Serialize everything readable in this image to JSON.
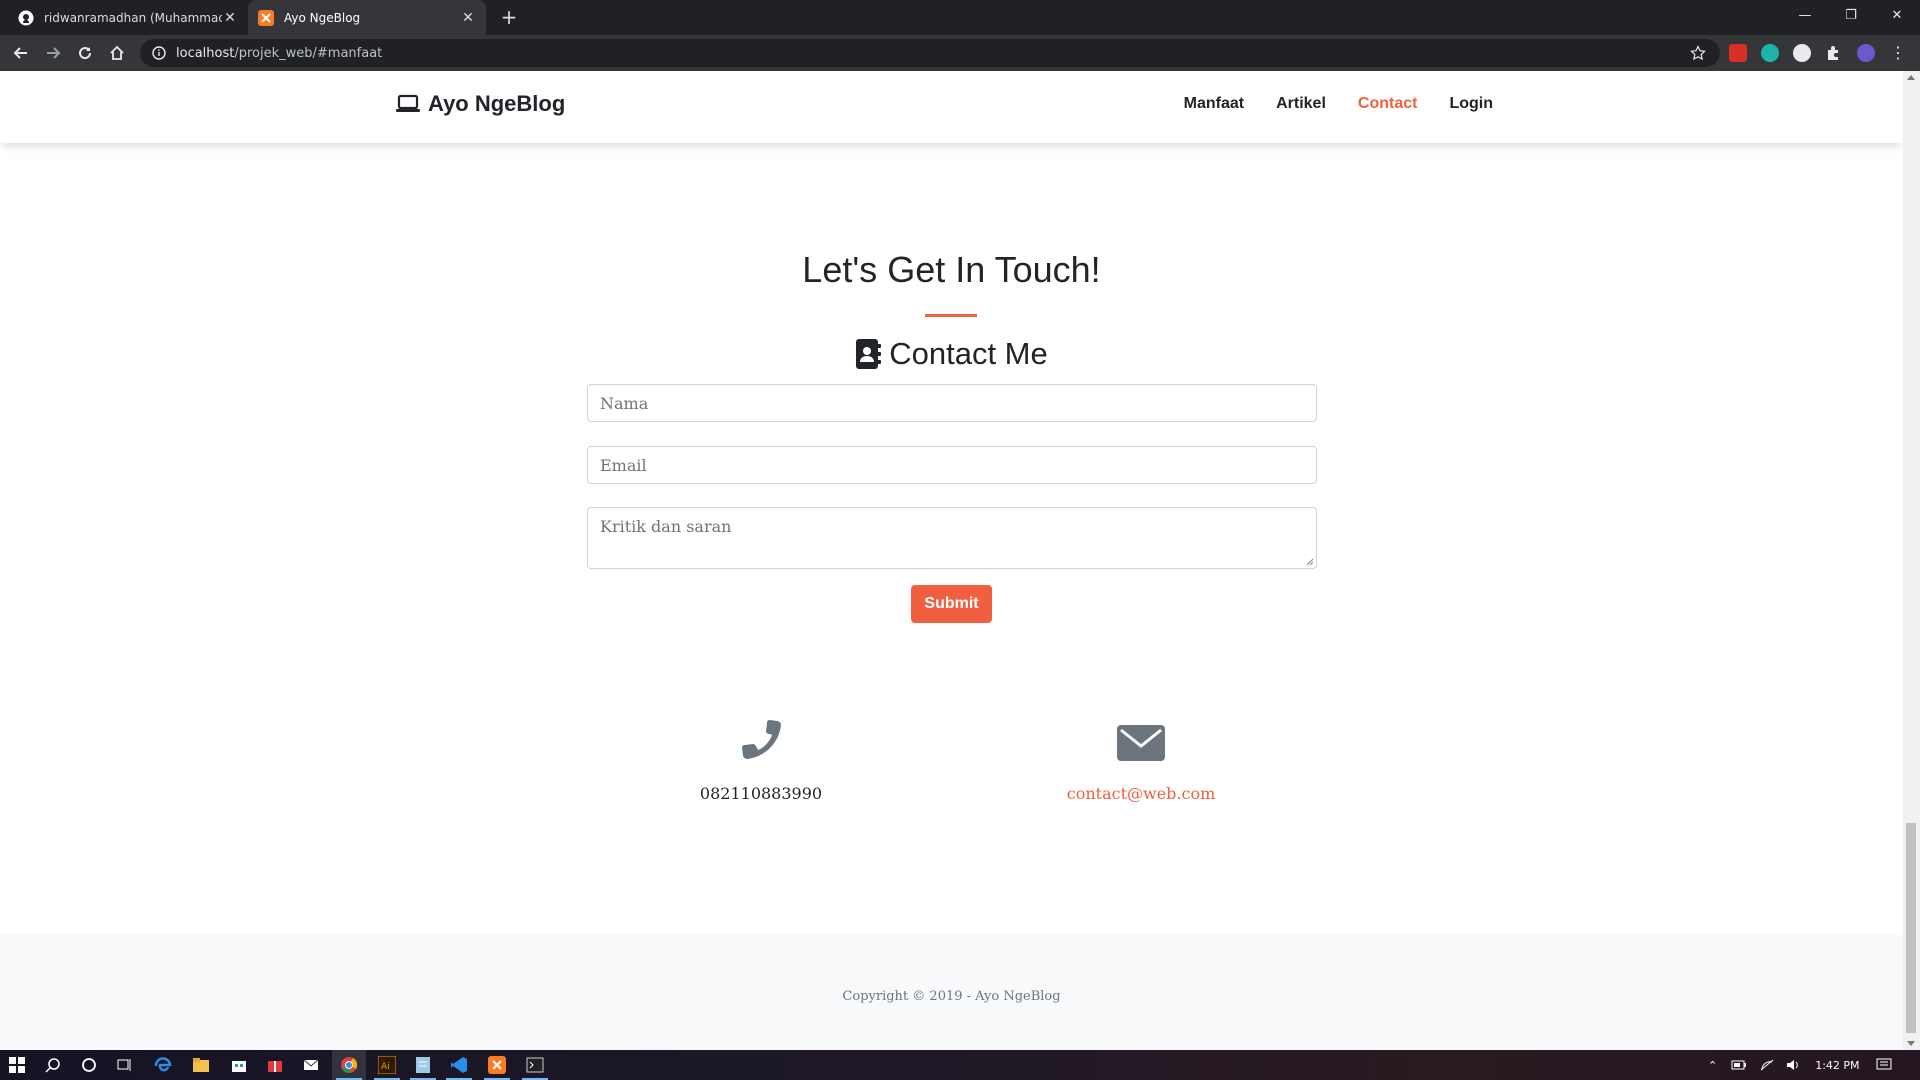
{
  "browser": {
    "tabs": [
      {
        "title": "ridwanramadhan (Muhammad Ri",
        "icon": "github-icon",
        "active": false
      },
      {
        "title": "Ayo NgeBlog",
        "icon": "xampp-icon",
        "active": true
      }
    ],
    "url_host": "localhost",
    "url_path": "/projek_web/#manfaat"
  },
  "navbar": {
    "brand": "Ayo NgeBlog",
    "links": [
      "Manfaat",
      "Artikel",
      "Contact",
      "Login"
    ],
    "active": "Contact"
  },
  "section": {
    "title": "Let's Get In Touch!",
    "contact_heading": "Contact Me"
  },
  "form": {
    "name_placeholder": "Nama",
    "email_placeholder": "Email",
    "message_placeholder": "Kritik dan saran",
    "submit_label": "Submit"
  },
  "contact_info": {
    "phone": "082110883990",
    "email": "contact@web.com"
  },
  "footer": {
    "copyright": "Copyright © 2019 - Ayo NgeBlog"
  },
  "taskbar": {
    "time": "1:42 PM"
  },
  "colors": {
    "accent": "#f05f40",
    "chrome_dark": "#202124",
    "chrome_toolbar": "#35363a"
  }
}
